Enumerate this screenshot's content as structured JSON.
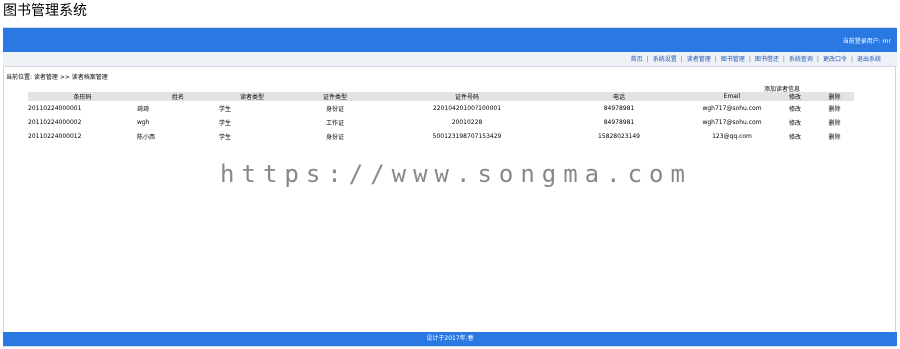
{
  "app": {
    "title": "图书管理系统"
  },
  "header": {
    "login_text": "当前登录用户: mr"
  },
  "menu": {
    "items": [
      "首页",
      "系统设置",
      "读者管理",
      "图书管理",
      "图书借还",
      "系统查询",
      "更改口令",
      "退出系统"
    ]
  },
  "breadcrumb": {
    "text": "当前位置: 读者管理 >> 读者档案管理"
  },
  "actions": {
    "add_label": "添加读者信息"
  },
  "table": {
    "headers": [
      "条形码",
      "姓名",
      "读者类型",
      "证件类型",
      "证件号码",
      "电话",
      "Email",
      "修改",
      "删除"
    ],
    "rows": [
      [
        "20110224000001",
        "琦琦",
        "学生",
        "身份证",
        "22010420100?100001",
        "84978981",
        "wgh717@sohu.com",
        "修改",
        "删除"
      ],
      [
        "20110224000002",
        "wgh",
        "学生",
        "工作证",
        "20010228",
        "84978981",
        "wgh717@sohu.com",
        "修改",
        "删除"
      ],
      [
        "20110224000012",
        "陈小西",
        "学生",
        "身份证",
        "500123198707153429",
        "15828023149",
        "123@qq.com",
        "修改",
        "删除"
      ]
    ]
  },
  "watermark": {
    "text": "https://www.songma.com"
  },
  "footer": {
    "text": "设计于2017年.春"
  },
  "colors": {
    "header_blue": "#2a79e3",
    "menu_bg": "#eef1f6",
    "th_bg": "#e3e3e3"
  }
}
